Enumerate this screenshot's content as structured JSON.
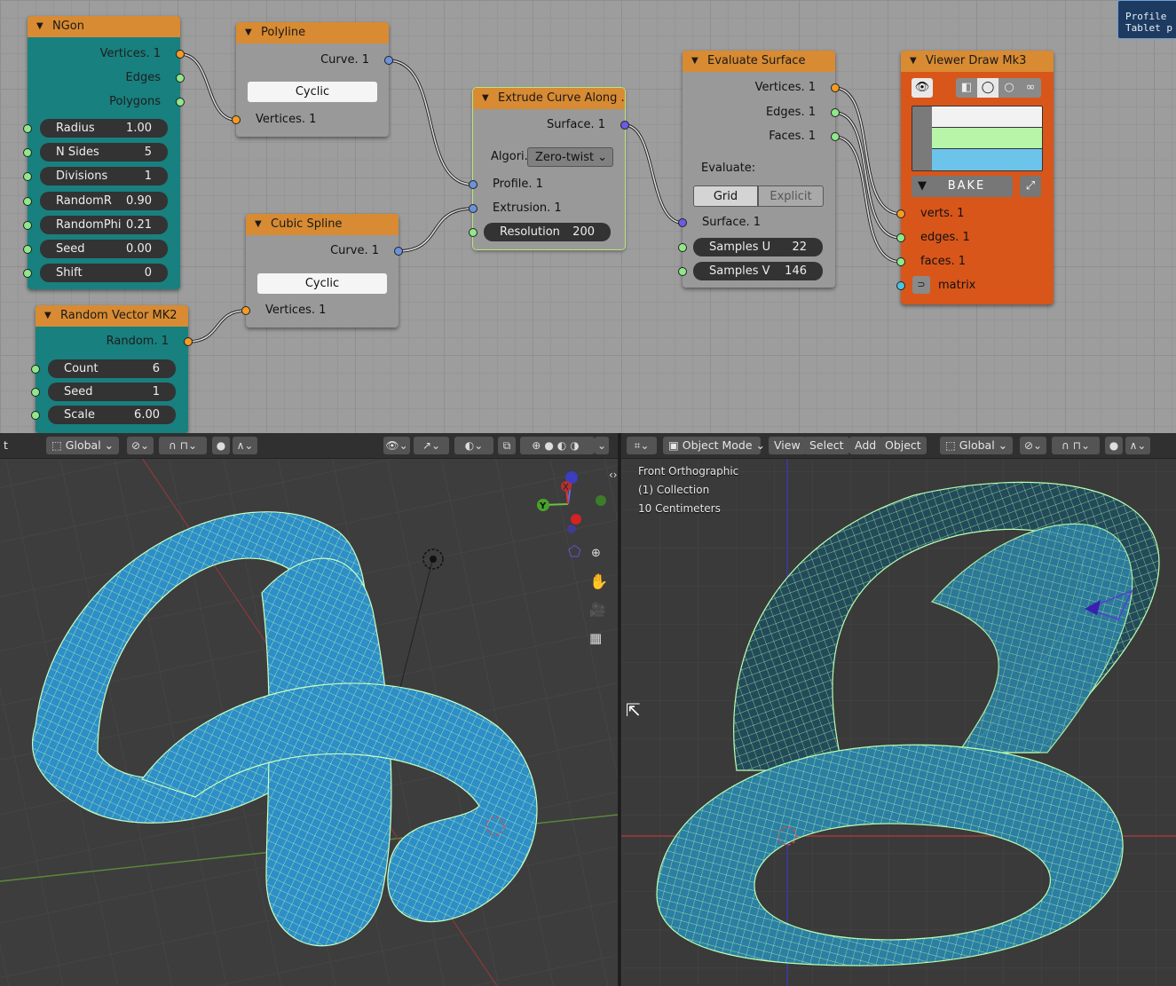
{
  "toast": {
    "line1": "Profile",
    "line2": "Tablet p"
  },
  "colors": {
    "node_header": "#d88b32",
    "node_teal": "#18807f",
    "node_viewer": "#d8561a",
    "socket_vertices": "#f39c23",
    "socket_numbers": "#8fe88a",
    "socket_curve": "#6b92dc",
    "socket_surface": "#6a5ce6",
    "socket_matrix": "#49c4e3",
    "mesh_blue": "#2f8fc4",
    "wire_green": "#9cf59c"
  },
  "nodes": {
    "ngon": {
      "title": "NGon",
      "outputs": [
        "Vertices. 1",
        "Edges",
        "Polygons"
      ],
      "fields": [
        {
          "label": "Radius",
          "value": "1.00"
        },
        {
          "label": "N Sides",
          "value": "5"
        },
        {
          "label": "Divisions",
          "value": "1"
        },
        {
          "label": "RandomR",
          "value": "0.90"
        },
        {
          "label": "RandomPhi",
          "value": "0.21"
        },
        {
          "label": "Seed",
          "value": "0.00"
        },
        {
          "label": "Shift",
          "value": "0"
        }
      ]
    },
    "polyline": {
      "title": "Polyline",
      "output": "Curve. 1",
      "cyclic_label": "Cyclic",
      "input": "Vertices. 1"
    },
    "cubic_spline": {
      "title": "Cubic Spline",
      "output": "Curve. 1",
      "cyclic_label": "Cyclic",
      "input": "Vertices. 1"
    },
    "random_vector": {
      "title": "Random Vector MK2",
      "output": "Random. 1",
      "fields": [
        {
          "label": "Count",
          "value": "6"
        },
        {
          "label": "Seed",
          "value": "1"
        },
        {
          "label": "Scale",
          "value": "6.00"
        }
      ]
    },
    "extrude": {
      "title": "Extrude Curve Along ..",
      "output": "Surface. 1",
      "algorithm_label": "Algori..",
      "algorithm_value": "Zero-twist",
      "inputs": [
        "Profile. 1",
        "Extrusion. 1"
      ],
      "resolution_label": "Resolution",
      "resolution_value": "200"
    },
    "evaluate": {
      "title": "Evaluate Surface",
      "outputs": [
        "Vertices. 1",
        "Edges. 1",
        "Faces. 1"
      ],
      "evaluate_label": "Evaluate:",
      "mode_grid": "Grid",
      "mode_explicit": "Explicit",
      "mode_selected": "Grid",
      "input": "Surface. 1",
      "fields": [
        {
          "label": "Samples U",
          "value": "22"
        },
        {
          "label": "Samples V",
          "value": "146"
        }
      ]
    },
    "viewer": {
      "title": "Viewer Draw Mk3",
      "bake_label": "BAKE",
      "vertex_color": "#f2f2f2",
      "edge_color": "#b8f5a8",
      "face_color": "#6cc4ea",
      "inputs": [
        "verts. 1",
        "edges. 1",
        "faces. 1",
        "matrix"
      ]
    }
  },
  "left_viewport": {
    "toolbar": {
      "partial": "t",
      "orientation": "Global"
    },
    "gizmo": {
      "x_label": "X",
      "y_label": "Y"
    }
  },
  "right_viewport": {
    "toolbar": {
      "mode": "Object Mode",
      "menus": [
        "View",
        "Select",
        "Add",
        "Object"
      ],
      "orientation": "Global"
    },
    "overlay": {
      "view_name": "Front Orthographic",
      "collection": "(1) Collection",
      "scale": "10 Centimeters"
    }
  }
}
